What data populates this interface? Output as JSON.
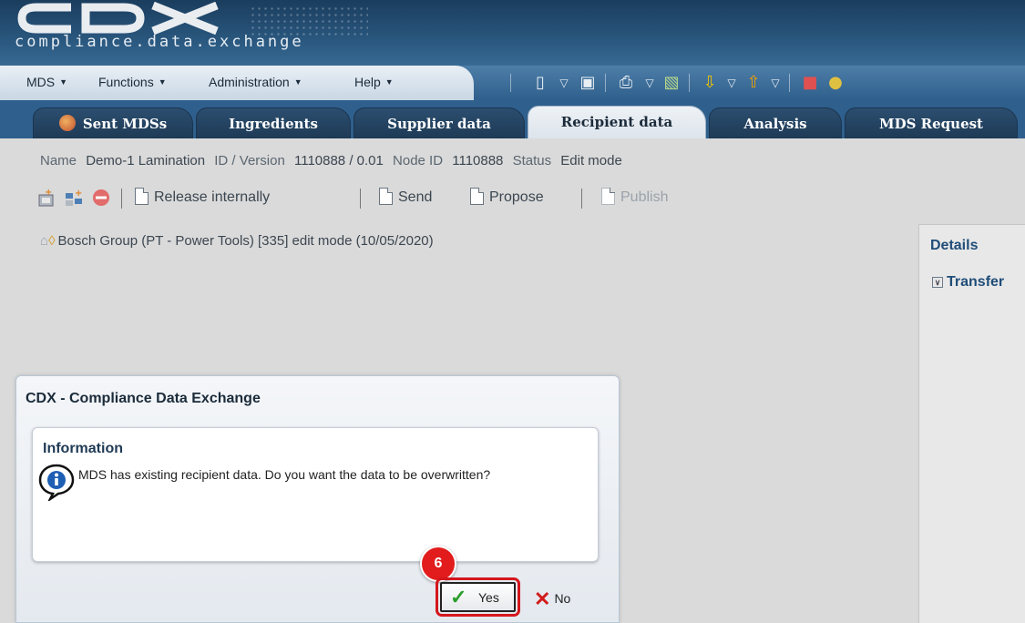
{
  "header": {
    "logo_text": "compliance.data.exchange"
  },
  "menu": {
    "items": [
      {
        "label": "MDS"
      },
      {
        "label": "Functions"
      },
      {
        "label": "Administration"
      },
      {
        "label": "Help"
      }
    ]
  },
  "toolbar": {
    "icons": [
      "new-document-icon",
      "dropdown-icon",
      "save-icon",
      "print-icon",
      "dropdown-icon",
      "checked-document-icon",
      "import-icon",
      "dropdown-icon",
      "export-icon",
      "dropdown-icon",
      "red-cube-icon",
      "yellow-sphere-icon"
    ]
  },
  "tabs": [
    {
      "label": "Sent MDSs",
      "active": false,
      "icon": "sent-mds-icon"
    },
    {
      "label": "Ingredients",
      "active": false
    },
    {
      "label": "Supplier data",
      "active": false
    },
    {
      "label": "Recipient data",
      "active": true
    },
    {
      "label": "Analysis",
      "active": false
    },
    {
      "label": "MDS Request",
      "active": false
    }
  ],
  "info": {
    "name_label": "Name",
    "name_value": "Demo-1 Lamination",
    "id_label": "ID / Version",
    "id_value": "1110888 / 0.01",
    "node_label": "Node ID",
    "node_value": "1110888",
    "status_label": "Status",
    "status_value": "Edit mode"
  },
  "actions": {
    "release": "Release internally",
    "send": "Send",
    "propose": "Propose",
    "publish": "Publish"
  },
  "tree": {
    "text": "Bosch Group (PT - Power Tools) [335]  edit mode (10/05/2020)"
  },
  "details": {
    "title": "Details",
    "transfer": "Transfer"
  },
  "dialog": {
    "title": "CDX - Compliance Data Exchange",
    "info_title": "Information",
    "message": "MDS has existing recipient data. Do you want the data to be overwritten?",
    "yes_label": "Yes",
    "no_label": "No",
    "step_number": "6"
  },
  "colors": {
    "highlight": "#d4171c",
    "header_dark": "#1a3d5e",
    "tab_bar": "#2f5f8c"
  }
}
